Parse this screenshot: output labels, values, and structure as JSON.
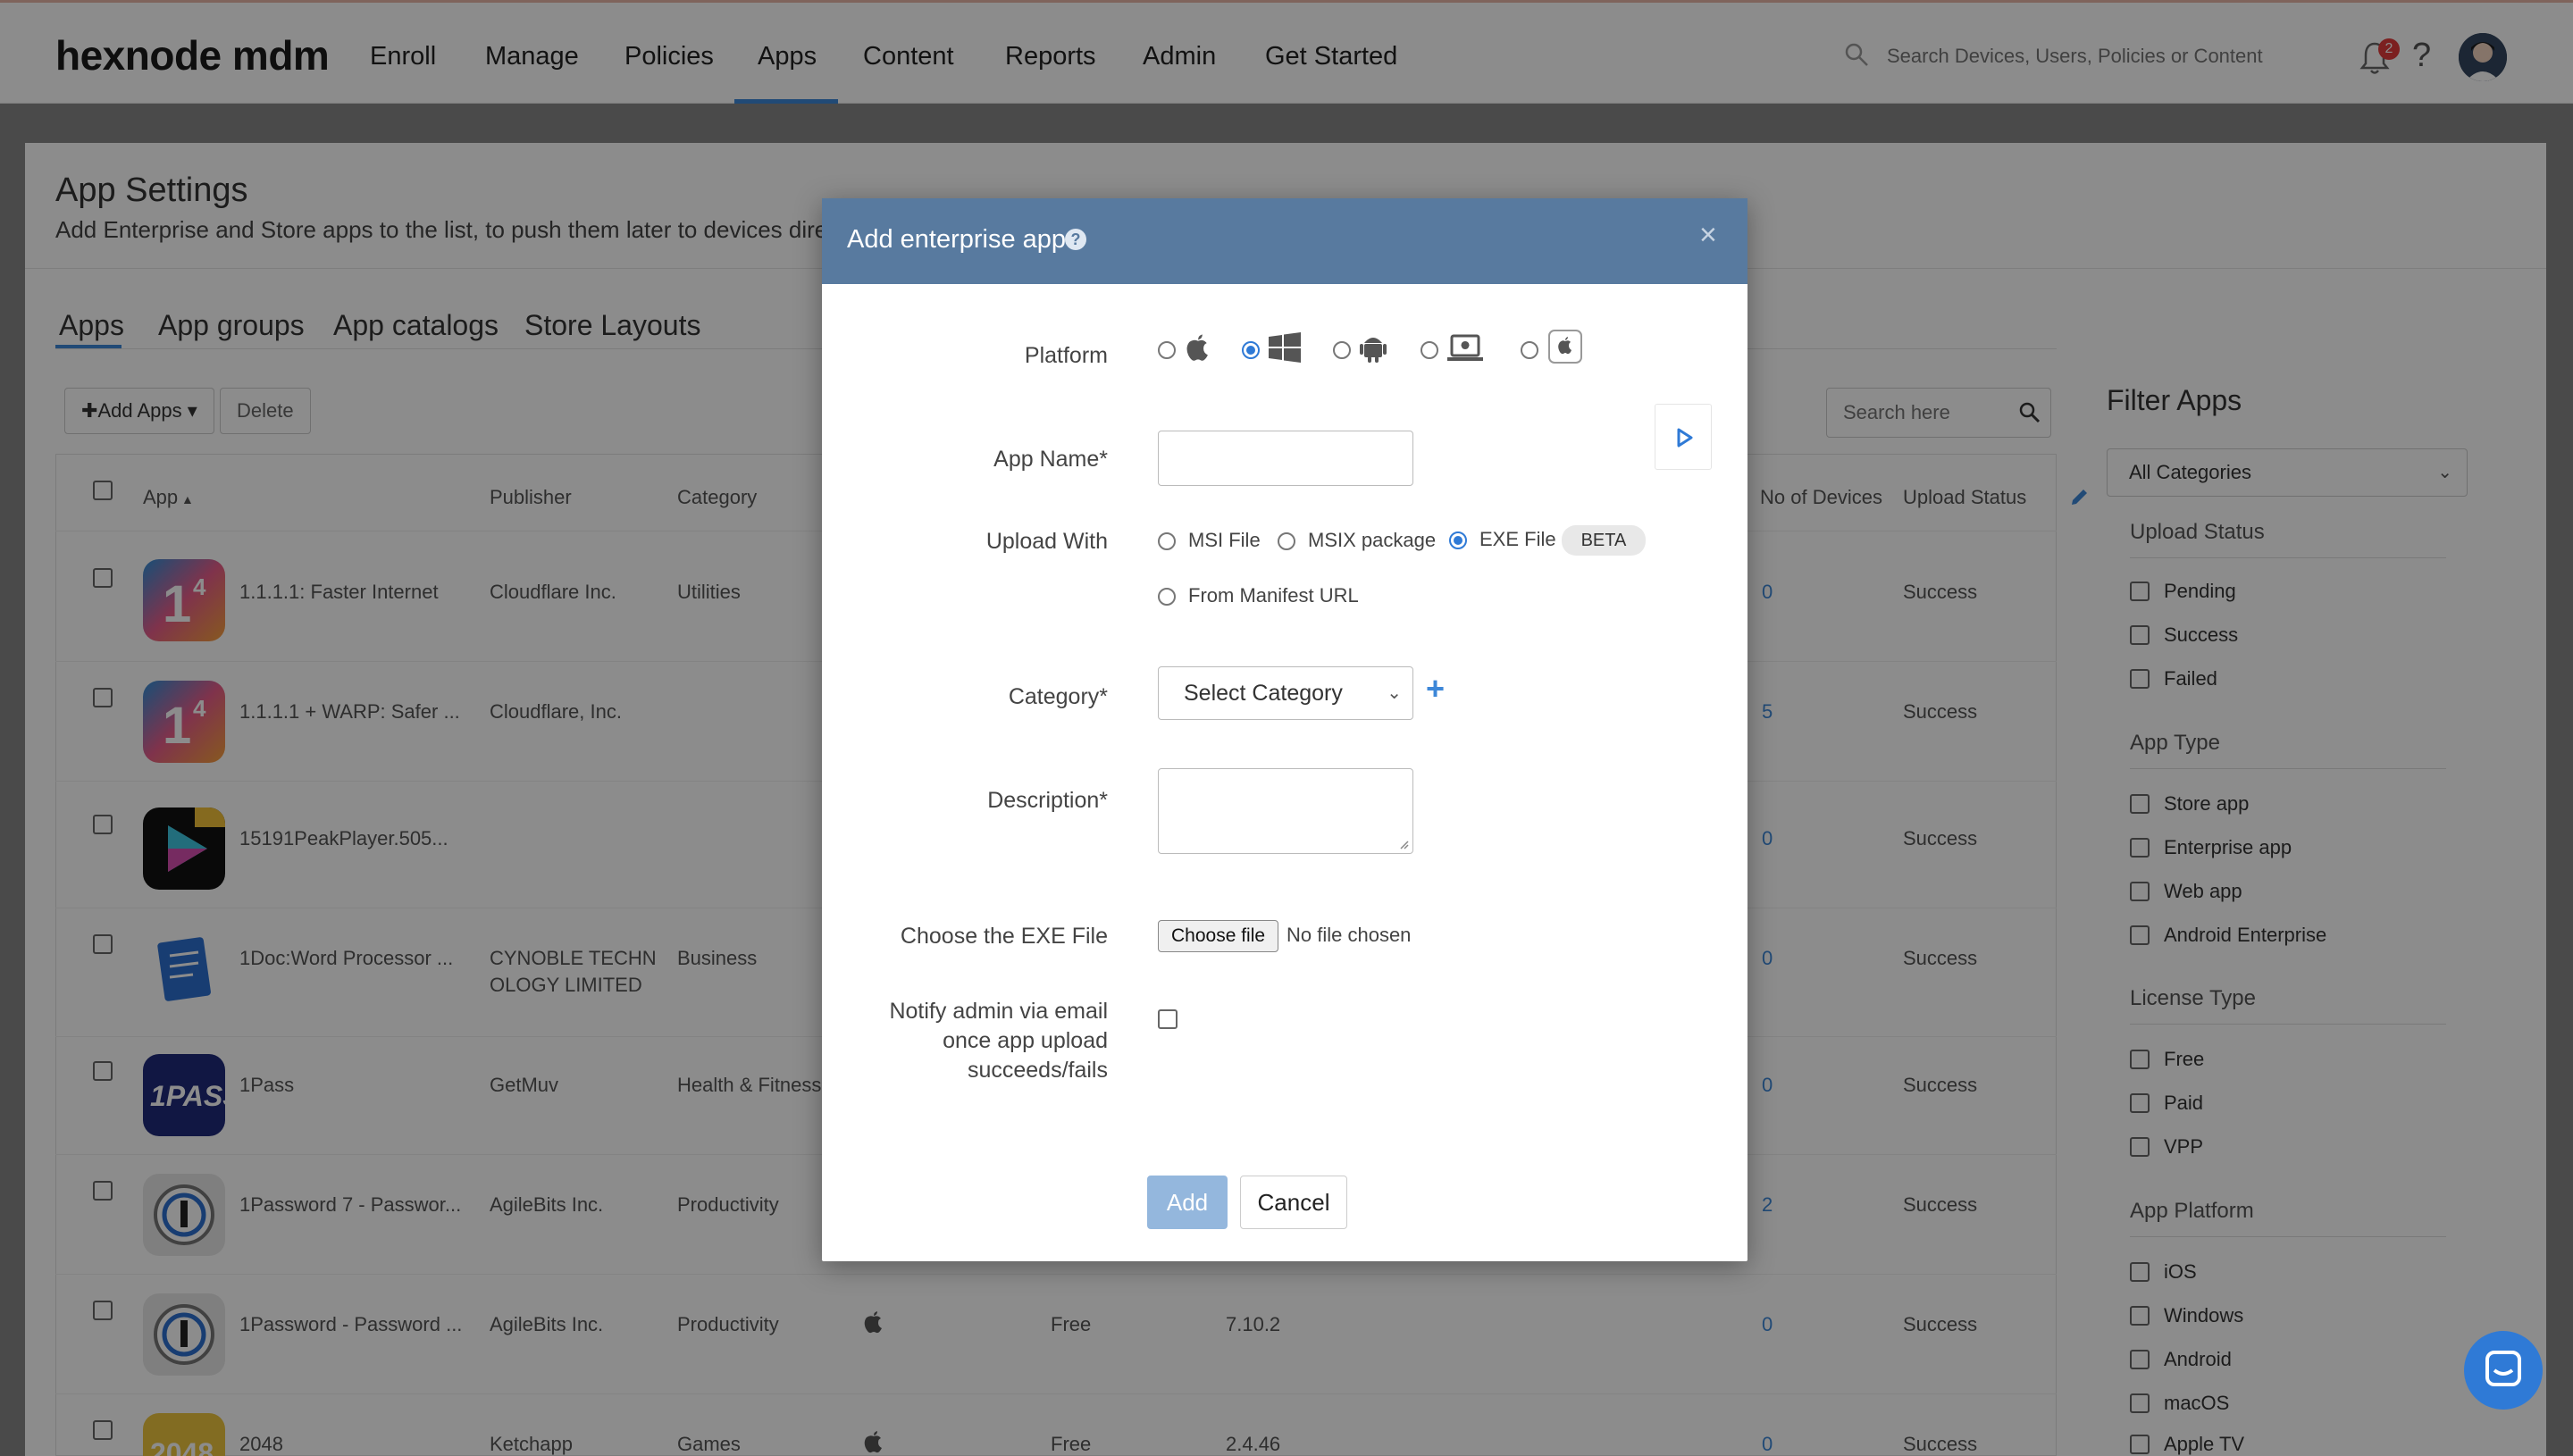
{
  "brand": {
    "logo": "hexnode mdm",
    "accent": "#3d87d8",
    "modal_header": "#587a9f"
  },
  "nav": {
    "items": [
      "Enroll",
      "Manage",
      "Policies",
      "Apps",
      "Content",
      "Reports",
      "Admin",
      "Get Started"
    ],
    "active": "Apps"
  },
  "global_search": {
    "placeholder": "Search Devices, Users, Policies or Content"
  },
  "notifications": {
    "count": "2"
  },
  "help": {
    "glyph": "?"
  },
  "page": {
    "title": "App Settings",
    "subtitle": "Add Enterprise and Store apps to the list, to push them later to devices directly."
  },
  "tabs": [
    "Apps",
    "App groups",
    "App catalogs",
    "Store Layouts"
  ],
  "toolbar": {
    "add_apps": "Add Apps",
    "delete": "Delete",
    "search_placeholder": "Search here"
  },
  "table": {
    "headers": {
      "app": "App",
      "publisher": "Publisher",
      "category": "Category",
      "devices": "No of Devices",
      "upload": "Upload Status"
    },
    "rows": [
      {
        "name": "1.1.1.1: Faster Internet",
        "publisher": "Cloudflare Inc.",
        "category": "Utilities",
        "platform": "",
        "license": "",
        "version": "",
        "devices": "0",
        "status": "Success"
      },
      {
        "name": "1.1.1.1 + WARP: Safer ...",
        "publisher": "Cloudflare, Inc.",
        "category": "",
        "platform": "",
        "license": "",
        "version": "",
        "devices": "5",
        "status": "Success"
      },
      {
        "name": "15191PeakPlayer.505...",
        "publisher": "",
        "category": "",
        "platform": "",
        "license": "",
        "version": "",
        "devices": "0",
        "status": "Success"
      },
      {
        "name": "1Doc:Word Processor ...",
        "publisher": "CYNOBLE TECHN",
        "publisher2": "OLOGY LIMITED",
        "category": "Business",
        "platform": "",
        "license": "",
        "version": "",
        "devices": "0",
        "status": "Success"
      },
      {
        "name": "1Pass",
        "publisher": "GetMuv",
        "category": "Health & Fitness",
        "platform": "",
        "license": "",
        "version": "",
        "devices": "0",
        "status": "Success"
      },
      {
        "name": "1Password 7 - Passwor...",
        "publisher": "AgileBits Inc.",
        "category": "Productivity",
        "platform": "",
        "license": "",
        "version": "",
        "devices": "2",
        "status": "Success"
      },
      {
        "name": "1Password - Password ...",
        "publisher": "AgileBits Inc.",
        "category": "Productivity",
        "platform": "apple",
        "license": "Free",
        "version": "7.10.2",
        "devices": "0",
        "status": "Success"
      },
      {
        "name": "2048",
        "publisher": "Ketchapp",
        "category": "Games",
        "platform": "apple",
        "license": "Free",
        "version": "2.4.46",
        "devices": "0",
        "status": "Success"
      }
    ]
  },
  "filter": {
    "title": "Filter Apps",
    "category_select": "All Categories",
    "sections": [
      {
        "title": "Upload Status",
        "options": [
          "Pending",
          "Success",
          "Failed"
        ]
      },
      {
        "title": "App Type",
        "options": [
          "Store app",
          "Enterprise app",
          "Web app",
          "Android Enterprise"
        ]
      },
      {
        "title": "License Type",
        "options": [
          "Free",
          "Paid",
          "VPP"
        ]
      },
      {
        "title": "App Platform",
        "options": [
          "iOS",
          "Windows",
          "Android",
          "macOS",
          "Apple TV"
        ]
      }
    ]
  },
  "modal": {
    "title": "Add enterprise app",
    "platform_label": "Platform",
    "platform_selected": "windows",
    "app_name_label": "App Name*",
    "app_name_value": "",
    "upload_label": "Upload With",
    "upload_options": [
      "MSI File",
      "MSIX package",
      "EXE File",
      "From Manifest URL"
    ],
    "upload_selected": "EXE File",
    "beta": "BETA",
    "category_label": "Category*",
    "category_value": "Select Category",
    "description_label": "Description*",
    "description_value": "",
    "choose_label": "Choose the EXE File",
    "choose_button": "Choose file",
    "no_file": "No file chosen",
    "notify_label_1": "Notify admin via email",
    "notify_label_2": "once app upload",
    "notify_label_3": "succeeds/fails",
    "add": "Add",
    "cancel": "Cancel"
  }
}
